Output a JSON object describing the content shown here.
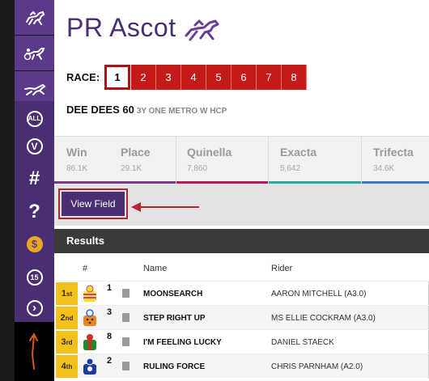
{
  "sidebar": {
    "items": [
      {
        "icon": "horse-racing-icon"
      },
      {
        "icon": "harness-racing-icon"
      },
      {
        "icon": "greyhound-icon"
      },
      {
        "icon": "all-icon",
        "label": "ALL"
      },
      {
        "icon": "v-icon",
        "label": "V"
      },
      {
        "icon": "hash-icon",
        "label": "#"
      },
      {
        "icon": "question-icon",
        "label": "?"
      },
      {
        "icon": "dollar-icon",
        "label": "$"
      },
      {
        "icon": "15-icon",
        "label": "15"
      },
      {
        "icon": "chevron-right-icon",
        "label": "›"
      }
    ]
  },
  "header": {
    "title": "PR Ascot",
    "race_label": "RACE:",
    "races": [
      "1",
      "2",
      "3",
      "4",
      "5",
      "6",
      "7",
      "8"
    ],
    "active_race": "1",
    "race_name": "DEE DEES 60",
    "race_class": "3Y ONE METRO W HCP"
  },
  "pools": [
    {
      "name": "Win",
      "value": "86.1K"
    },
    {
      "name": "Place",
      "value": "29.1K"
    },
    {
      "name": "Quinella",
      "value": "7,860"
    },
    {
      "name": "Exacta",
      "value": "5,642"
    },
    {
      "name": "Trifecta",
      "value": "34.6K"
    }
  ],
  "view_field": {
    "label": "View Field"
  },
  "results": {
    "title": "Results",
    "columns": {
      "num": "#",
      "name": "Name",
      "rider": "Rider"
    },
    "rows": [
      {
        "pos": "1",
        "suffix": "st",
        "num": "1",
        "name": "MOONSEARCH",
        "rider": "AARON MITCHELL (A3.0)"
      },
      {
        "pos": "2",
        "suffix": "nd",
        "num": "3",
        "name": "STEP RIGHT UP",
        "rider": "MS ELLIE COCKRAM (A3.0)"
      },
      {
        "pos": "3",
        "suffix": "rd",
        "num": "8",
        "name": "I'M FEELING LUCKY",
        "rider": "DANIEL STAECK"
      },
      {
        "pos": "4",
        "suffix": "th",
        "num": "2",
        "name": "RULING FORCE",
        "rider": "CHRIS PARNHAM (A2.0)"
      }
    ]
  },
  "colors": {
    "brand_purple": "#4a2e72",
    "race_red": "#c41a1a",
    "position_gold": "#f2c21b",
    "win_bar": "#7a3a8a",
    "quinella_bar": "#b31b5a",
    "exacta_bar": "#2aa8a0",
    "trifecta_bar": "#3a7ac0"
  }
}
